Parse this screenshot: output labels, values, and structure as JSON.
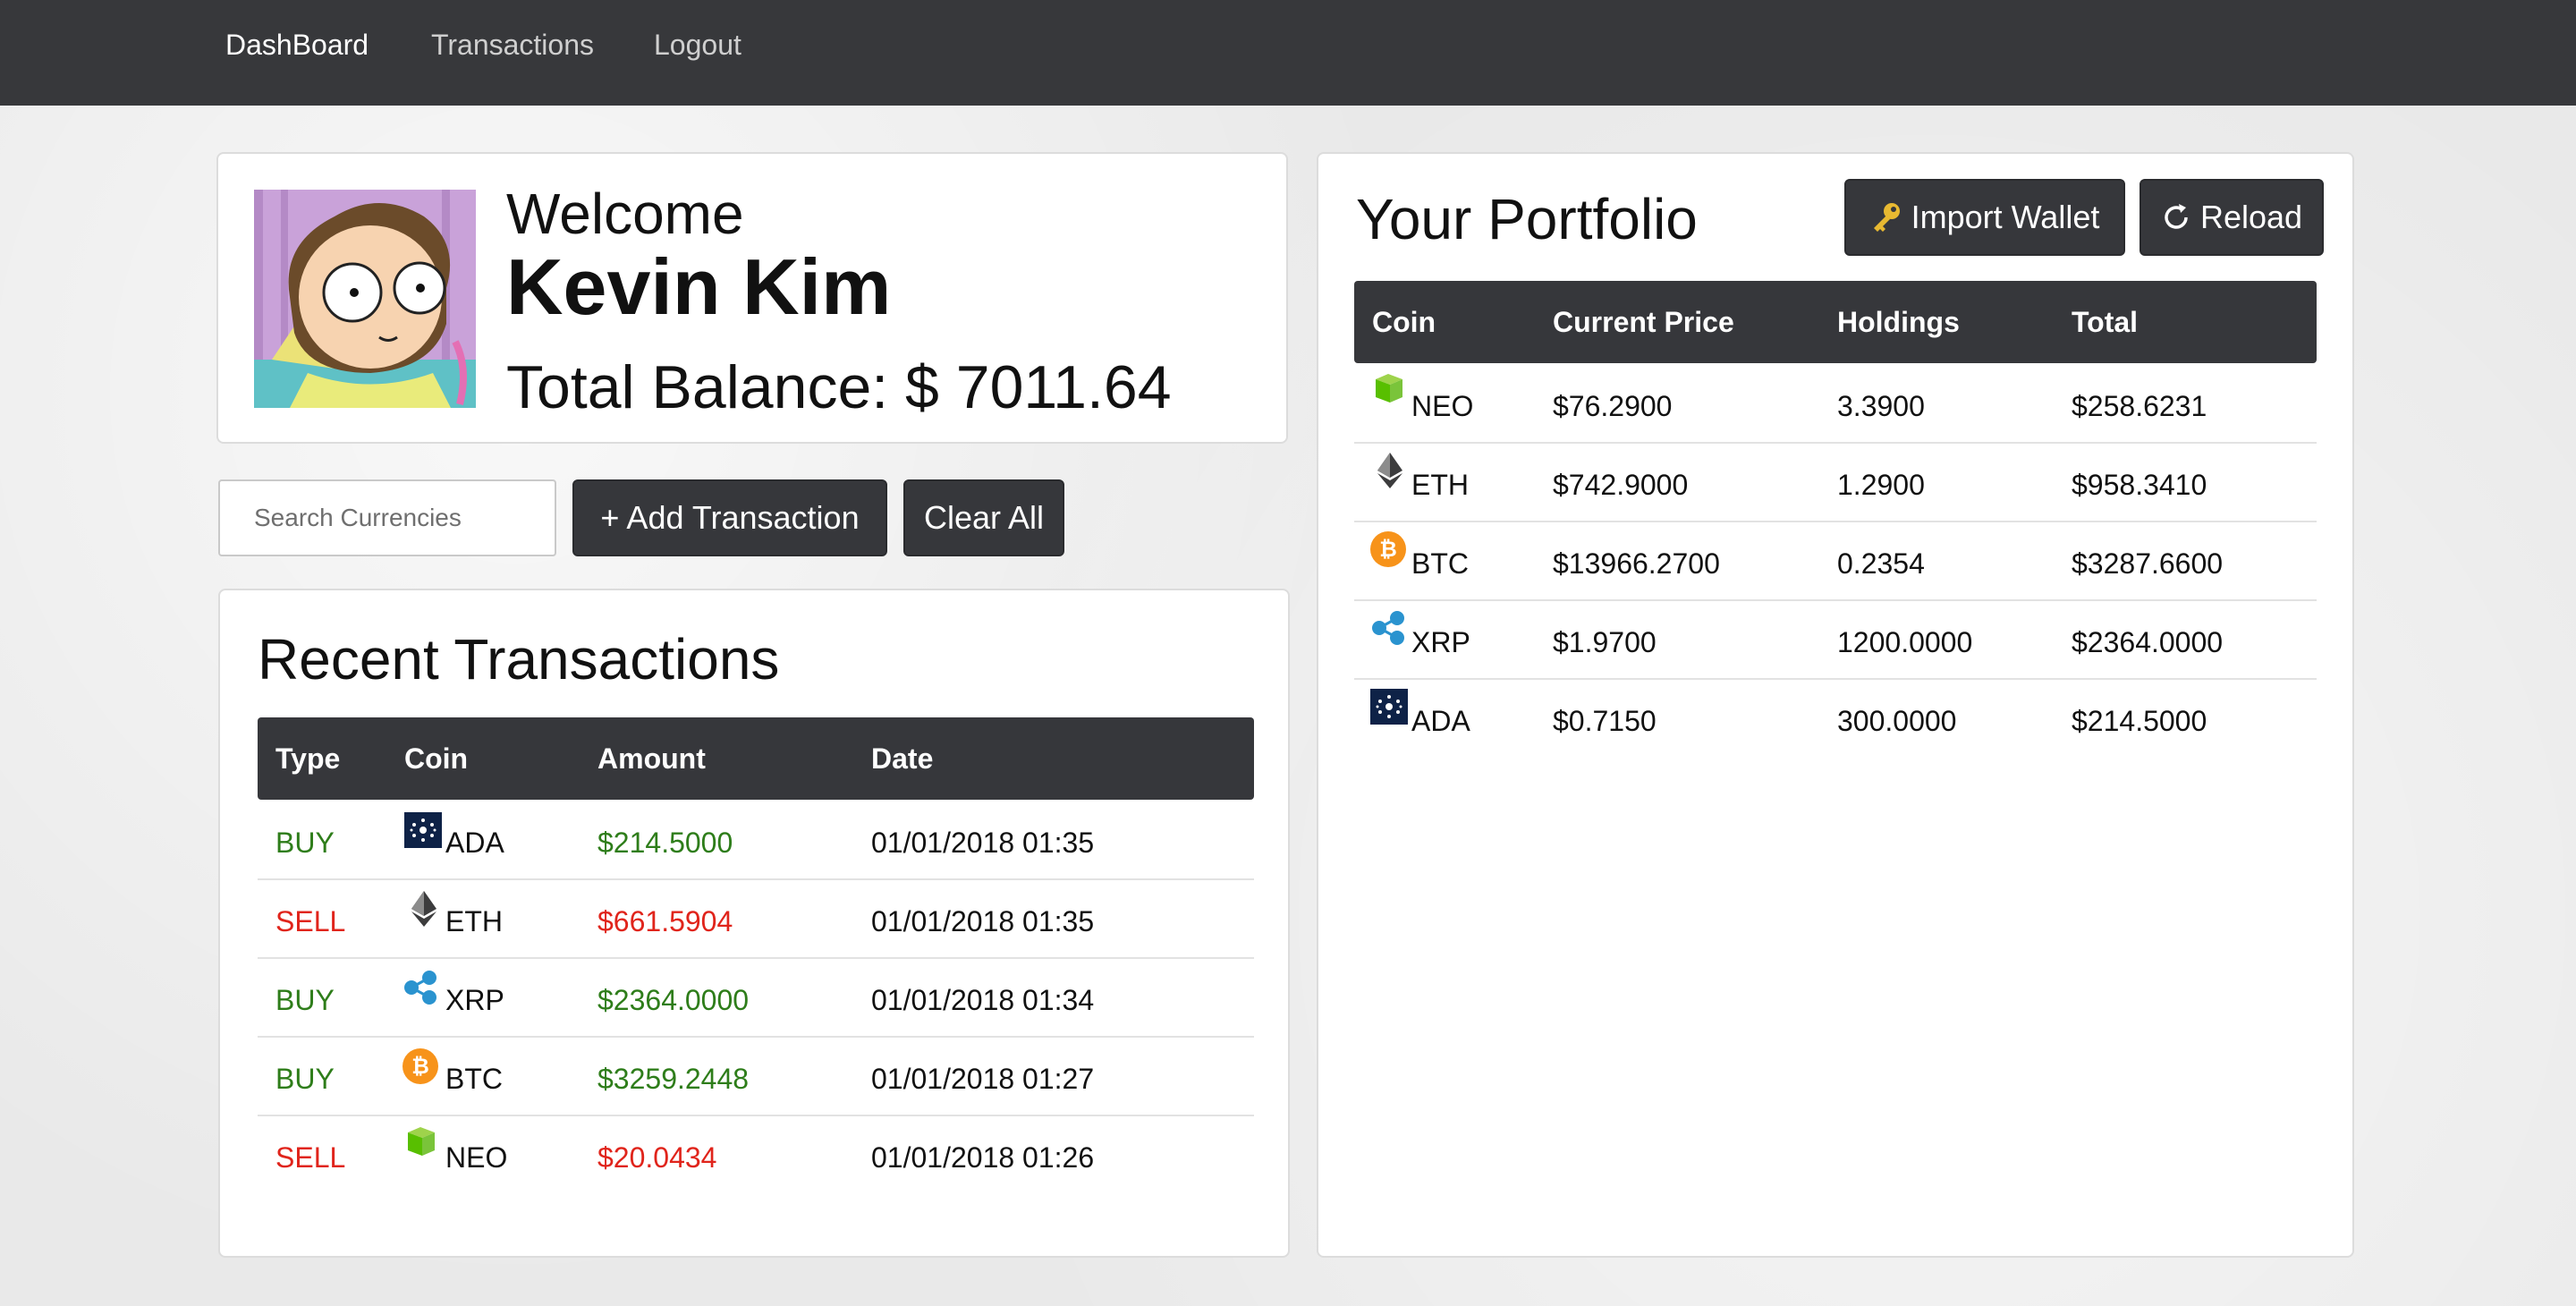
{
  "nav": {
    "dashboard": "DashBoard",
    "transactions": "Transactions",
    "logout": "Logout"
  },
  "profile": {
    "welcome": "Welcome",
    "name": "Kevin Kim",
    "balance_label": "Total Balance: $ 7011.64"
  },
  "controls": {
    "search_placeholder": "Search Currencies",
    "add_transaction": "+ Add Transaction",
    "clear_all": "Clear All"
  },
  "recent": {
    "title": "Recent Transactions",
    "headers": [
      "Type",
      "Coin",
      "Amount",
      "Date"
    ],
    "rows": [
      {
        "type": "BUY",
        "coin": "ADA",
        "amount": "$214.5000",
        "date": "01/01/2018 01:35"
      },
      {
        "type": "SELL",
        "coin": "ETH",
        "amount": "$661.5904",
        "date": "01/01/2018 01:35"
      },
      {
        "type": "BUY",
        "coin": "XRP",
        "amount": "$2364.0000",
        "date": "01/01/2018 01:34"
      },
      {
        "type": "BUY",
        "coin": "BTC",
        "amount": "$3259.2448",
        "date": "01/01/2018 01:27"
      },
      {
        "type": "SELL",
        "coin": "NEO",
        "amount": "$20.0434",
        "date": "01/01/2018 01:26"
      }
    ]
  },
  "portfolio": {
    "title": "Your Portfolio",
    "import_wallet": "Import Wallet",
    "reload": "Reload",
    "headers": [
      "Coin",
      "Current Price",
      "Holdings",
      "Total"
    ],
    "rows": [
      {
        "coin": "NEO",
        "price": "$76.2900",
        "holdings": "3.3900",
        "total": "$258.6231"
      },
      {
        "coin": "ETH",
        "price": "$742.9000",
        "holdings": "1.2900",
        "total": "$958.3410"
      },
      {
        "coin": "BTC",
        "price": "$13966.2700",
        "holdings": "0.2354",
        "total": "$3287.6600"
      },
      {
        "coin": "XRP",
        "price": "$1.9700",
        "holdings": "1200.0000",
        "total": "$2364.0000"
      },
      {
        "coin": "ADA",
        "price": "$0.7150",
        "holdings": "300.0000",
        "total": "$214.5000"
      }
    ]
  },
  "colors": {
    "navbar": "#37383b",
    "buy": "#2e7d1a",
    "sell": "#e0241b",
    "button": "#36373b"
  },
  "icons": {
    "NEO": "neo-icon",
    "ETH": "eth-icon",
    "BTC": "btc-icon",
    "XRP": "xrp-icon",
    "ADA": "ada-icon",
    "import_wallet": "key-icon",
    "reload": "reload-icon"
  }
}
